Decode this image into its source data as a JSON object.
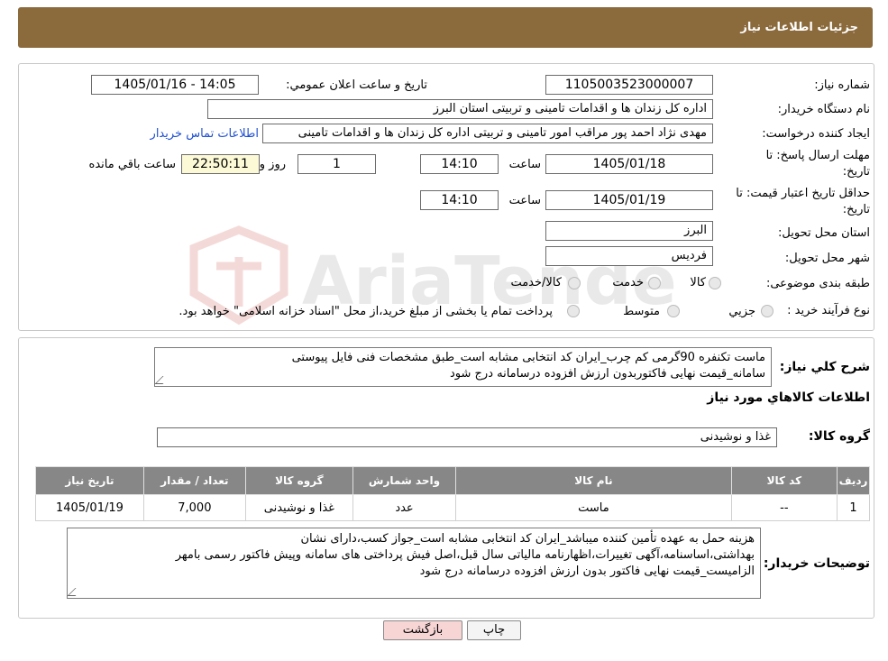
{
  "header": {
    "title": "جزئیات اطلاعات نیاز"
  },
  "form": {
    "need_number_label": "شماره نیاز:",
    "need_number": "1105003523000007",
    "announce_label": "تاریخ و ساعت اعلان عمومي:",
    "announce_value": "1405/01/16 - 14:05",
    "buyer_org_label": "نام دستگاه خریدار:",
    "buyer_org": "اداره کل زندان ها و اقدامات تامینی و تربیتی استان البرز",
    "requester_label": "ایجاد کننده درخواست:",
    "requester": "مهدی نژاد احمد پور مراقب امور تامینی و تربیتی اداره کل زندان ها و اقدامات تامینی",
    "contact_link": "اطلاعات تماس خریدار",
    "deadline_label_1": "مهلت ارسال پاسخ: تا",
    "deadline_label_2": "تاریخ:",
    "deadline_date": "1405/01/18",
    "time_word": "ساعت",
    "deadline_time": "14:10",
    "days": "1",
    "days_word": "روز و",
    "remaining_time": "22:50:11",
    "remaining_word": "ساعت باقي مانده",
    "price_label_1": "حداقل تاریخ اعتبار قیمت: تا",
    "price_label_2": "تاریخ:",
    "price_date": "1405/01/19",
    "price_time": "14:10",
    "province_label": "استان محل تحویل:",
    "province": "البرز",
    "city_label": "شهر محل تحویل:",
    "city": "فردیس",
    "category_label": "طبقه بندی موضوعی:",
    "category_options": [
      "کالا",
      "خدمت",
      "کالا/خدمت"
    ],
    "process_label": "نوع فرآیند خرید :",
    "process_options": [
      "جزیي",
      "متوسط"
    ],
    "process_note": "پرداخت تمام یا بخشی از مبلغ خرید،از محل \"اسناد خزانه اسلامی\" خواهد بود."
  },
  "summary": {
    "label": "شرح كلي نياز:",
    "text_line1": "ماست تکنفره 90گرمی کم چرب_ایران کد انتخابی مشابه است_طبق مشخصات فنی فایل پیوستی",
    "text_line2": "سامانه_قیمت نهایی فاکتوربدون ارزش افزوده درسامانه درج شود",
    "goods_info_title": "اطلاعات كالاهاي مورد نياز",
    "group_label": "گروه کالا:",
    "group_value": "غذا و نوشیدنی"
  },
  "table": {
    "headers": [
      "ردیف",
      "کد کالا",
      "نام کالا",
      "واحد شمارش",
      "گروه کالا",
      "تعداد / مقدار",
      "تاریخ نیاز"
    ],
    "rows": [
      [
        "1",
        "--",
        "ماست",
        "عدد",
        "غذا و نوشیدنی",
        "7,000",
        "1405/01/19"
      ]
    ]
  },
  "buyer_notes": {
    "label": "توضیحات خریدار:",
    "line1": "هزینه حمل به عهده تأمین کننده میباشد_ایران کد انتخابی مشابه است_جواز کسب،دارای نشان",
    "line2": "بهداشتی،اساسنامه،آگهی تغییرات،اظهارنامه مالیاتی سال قبل،اصل فیش پرداختی های سامانه وپیش فاکتور رسمی بامهر",
    "line3": "الزامیست_قیمت نهایی فاکتور بدون ارزش افزوده درسامانه درج شود"
  },
  "buttons": {
    "print": "چاپ",
    "back": "بازگشت"
  },
  "watermark": {
    "text": "AriaTender.neT"
  }
}
